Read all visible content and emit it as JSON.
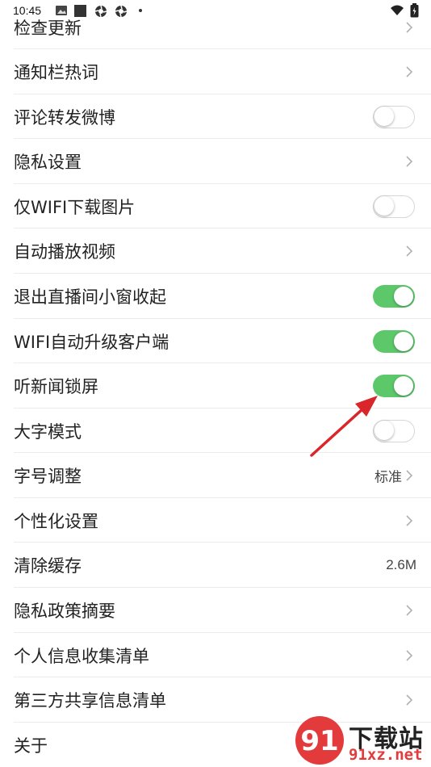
{
  "status_bar": {
    "time": "10:45",
    "icons": [
      "gallery-icon",
      "square-icon",
      "aperture-icon",
      "aperture-icon",
      "dot-icon",
      "wifi-icon",
      "battery-icon"
    ]
  },
  "settings": [
    {
      "label": "检查更新",
      "control": "chevron"
    },
    {
      "label": "通知栏热词",
      "control": "chevron"
    },
    {
      "label": "评论转发微博",
      "control": "toggle",
      "on": false
    },
    {
      "label": "隐私设置",
      "control": "chevron"
    },
    {
      "label": "仅WIFI下载图片",
      "control": "toggle",
      "on": false
    },
    {
      "label": "自动播放视频",
      "control": "chevron"
    },
    {
      "label": "退出直播间小窗收起",
      "control": "toggle",
      "on": true
    },
    {
      "label": "WIFI自动升级客户端",
      "control": "toggle",
      "on": true
    },
    {
      "label": "听新闻锁屏",
      "control": "toggle",
      "on": true
    },
    {
      "label": "大字模式",
      "control": "toggle",
      "on": false
    },
    {
      "label": "字号调整",
      "control": "value-chevron",
      "value": "标准"
    },
    {
      "label": "个性化设置",
      "control": "chevron"
    },
    {
      "label": "清除缓存",
      "control": "value",
      "value": "2.6M"
    },
    {
      "label": "隐私政策摘要",
      "control": "chevron"
    },
    {
      "label": "个人信息收集清单",
      "control": "chevron"
    },
    {
      "label": "第三方共享信息清单",
      "control": "chevron"
    },
    {
      "label": "关于",
      "control": "none"
    }
  ],
  "colors": {
    "toggle_on": "#5cc86a",
    "annotation_arrow": "#d9262b"
  },
  "watermark": {
    "top": "下载站",
    "bottom": "91xz.net"
  }
}
